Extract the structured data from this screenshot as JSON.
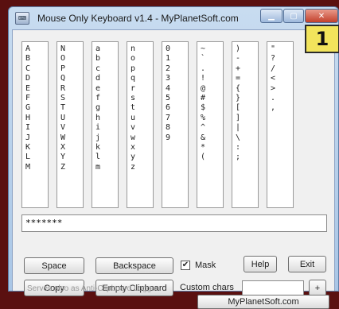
{
  "window": {
    "title": "Mouse Only Keyboard v1.4 - MyPlanetSoft.com",
    "app_icon": "keyboard-icon"
  },
  "badge": "1",
  "columns": [
    [
      "A",
      "B",
      "C",
      "D",
      "E",
      "F",
      "G",
      "H",
      "I",
      "J",
      "K",
      "L",
      "M"
    ],
    [
      "N",
      "O",
      "P",
      "Q",
      "R",
      "S",
      "T",
      "U",
      "V",
      "W",
      "X",
      "Y",
      "Z"
    ],
    [
      "a",
      "b",
      "c",
      "d",
      "e",
      "f",
      "g",
      "h",
      "i",
      "j",
      "k",
      "l",
      "m"
    ],
    [
      "n",
      "o",
      "p",
      "q",
      "r",
      "s",
      "t",
      "u",
      "v",
      "w",
      "x",
      "y",
      "z"
    ],
    [
      "0",
      "1",
      "2",
      "3",
      "4",
      "5",
      "6",
      "7",
      "8",
      "9"
    ],
    [
      "~",
      "`",
      ".",
      "!",
      "@",
      "#",
      "$",
      "%",
      "^",
      "&",
      "*",
      "("
    ],
    [
      ")",
      "-",
      "+",
      "=",
      "{",
      "}",
      "[",
      "]",
      "|",
      "\\",
      ":",
      ";"
    ],
    [
      "\"",
      "?",
      "/",
      "<",
      ">",
      ".",
      ","
    ]
  ],
  "input": {
    "value": "*******"
  },
  "buttons": {
    "space": "Space",
    "backspace": "Backspace",
    "help": "Help",
    "exit": "Exit",
    "copy": "Copy",
    "empty_clipboard": "Empty Clipboard",
    "plus": "+",
    "website": "MyPlanetSoft.com"
  },
  "mask": {
    "label": "Mask",
    "checked": true
  },
  "custom_chars_label": "Custom chars",
  "footer_text": "Serves also as Anti-Clipboard Logger",
  "colors": {
    "desktop": "#5a1010",
    "badge": "#f2e45c",
    "close": "#c2402c"
  }
}
